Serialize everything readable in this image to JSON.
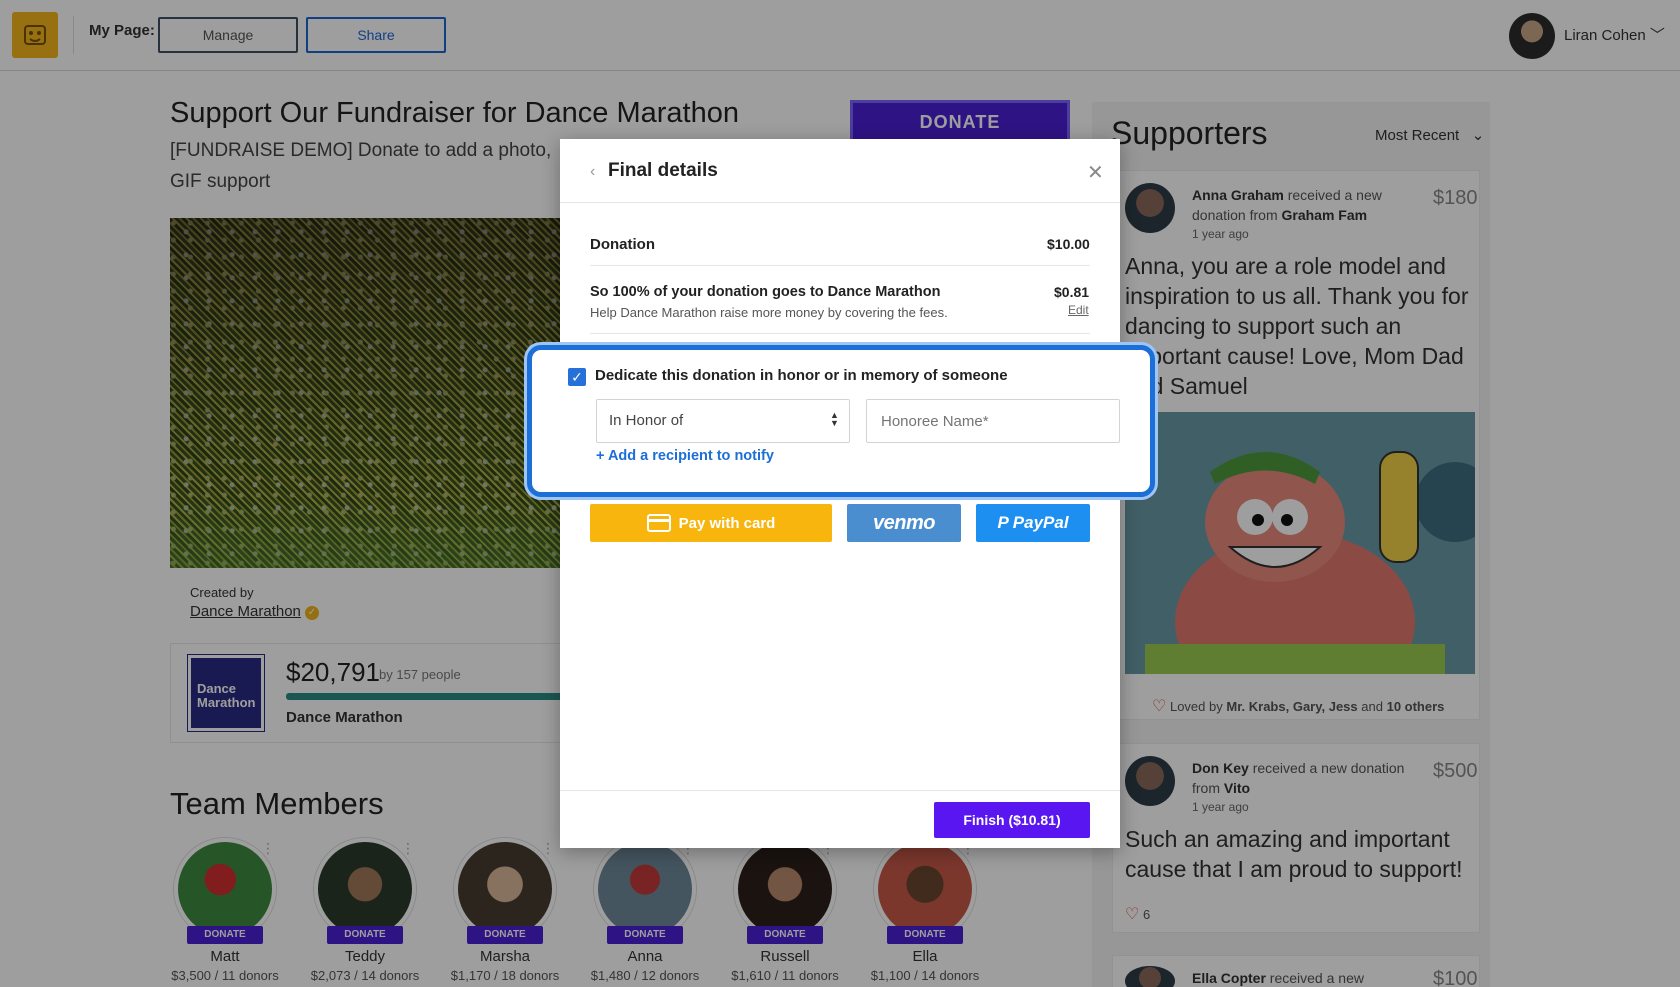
{
  "header": {
    "my_page_label": "My Page:",
    "manage_label": "Manage",
    "share_label": "Share",
    "user_name": "Liran Cohen"
  },
  "campaign": {
    "title": "Support Our Fundraiser for Dance Marathon",
    "subtitle": "[FUNDRAISE DEMO] Donate to add a photo, GIF support",
    "donate_button": "DONATE",
    "created_by_label": "Created by",
    "creator": "Dance Marathon",
    "logo_text": "Dance Marathon",
    "raised": "$20,791",
    "by_people": "by 157 people",
    "team_name": "Dance Marathon"
  },
  "team": {
    "heading": "Team Members",
    "donate_label": "DONATE",
    "members": [
      {
        "name": "Matt",
        "stat": "$3,500 / 11 donors"
      },
      {
        "name": "Teddy",
        "stat": "$2,073 / 14 donors"
      },
      {
        "name": "Marsha",
        "stat": "$1,170 / 18 donors"
      },
      {
        "name": "Anna",
        "stat": "$1,480 / 12 donors"
      },
      {
        "name": "Russell",
        "stat": "$1,610 / 11 donors"
      },
      {
        "name": "Ella",
        "stat": "$1,100 / 14 donors"
      }
    ]
  },
  "supporters": {
    "heading": "Supporters",
    "sort": "Most Recent",
    "items": [
      {
        "name": "Anna Graham",
        "action": "received a new donation from",
        "from": "Graham Fam",
        "amount": "$180",
        "ago": "1 year ago",
        "message": "Anna, you are a role model and inspiration to us all. Thank you for dancing to support such an important cause! Love, Mom Dad and Samuel",
        "loved_text": "Loved by",
        "loved_names": "Mr. Krabs, Gary, Jess",
        "loved_and": "and",
        "loved_others": "10 others"
      },
      {
        "name": "Don Key",
        "action": "received a new donation from",
        "from": "Vito",
        "amount": "$500",
        "ago": "1 year ago",
        "message": "Such an amazing and important cause that I am proud to support!",
        "likes": "6"
      },
      {
        "name": "Ella Copter",
        "action": "received a new",
        "amount": "$100"
      }
    ]
  },
  "modal": {
    "title": "Final details",
    "donation_label": "Donation",
    "donation_value": "$10.00",
    "fee_label": "So 100% of your donation goes to Dance Marathon",
    "fee_sub": "Help Dance Marathon raise more money by covering the fees.",
    "fee_value": "$0.81",
    "fee_edit": "Edit",
    "dedicate_label": "Dedicate this donation in honor or in memory of someone",
    "dedicate_select": "In Honor of",
    "honoree_placeholder": "Honoree Name*",
    "add_recipient": "+ Add a recipient to notify",
    "pay_card": "Pay with card",
    "pay_venmo": "venmo",
    "pay_paypal": "PayPal",
    "finish": "Finish ($10.81)"
  },
  "colors": {
    "brand_purple": "#5a16f0",
    "highlight_blue": "#1c6fd6",
    "card_yellow": "#f7b50e",
    "venmo_blue": "#4a8ed0",
    "paypal_blue": "#1d8ff0"
  }
}
